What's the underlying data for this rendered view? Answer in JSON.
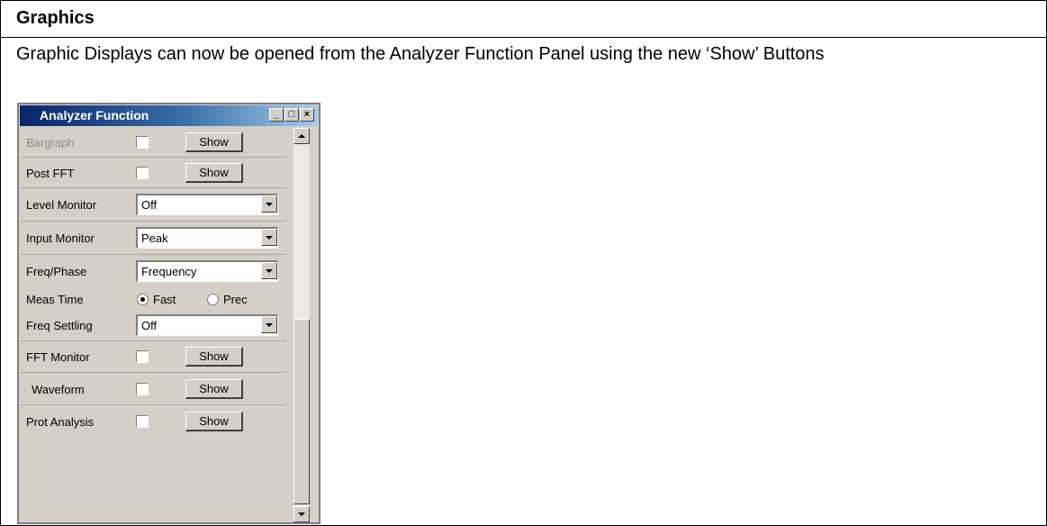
{
  "document": {
    "heading": "Graphics",
    "body": "Graphic Displays can now be opened from the Analyzer Function Panel using the new ‘Show’ Buttons"
  },
  "panel": {
    "title": "Analyzer Function",
    "minimize": "_",
    "maximize": "□",
    "close": "×",
    "rows": [
      {
        "label": "Bargraph",
        "show": "Show"
      },
      {
        "label": "Post FFT",
        "show": "Show"
      },
      {
        "label": "Level Monitor",
        "value": "Off"
      },
      {
        "label": "Input Monitor",
        "value": "Peak"
      },
      {
        "label": "Freq/Phase",
        "value": "Frequency"
      },
      {
        "label": "Meas Time",
        "option_1": "Fast",
        "option_2": "Prec"
      },
      {
        "label": "Freq Settling",
        "value": "Off"
      },
      {
        "label": "FFT Monitor",
        "show": "Show"
      },
      {
        "label": "Waveform",
        "show": "Show"
      },
      {
        "label": "Prot Analysis",
        "show": "Show"
      }
    ]
  }
}
